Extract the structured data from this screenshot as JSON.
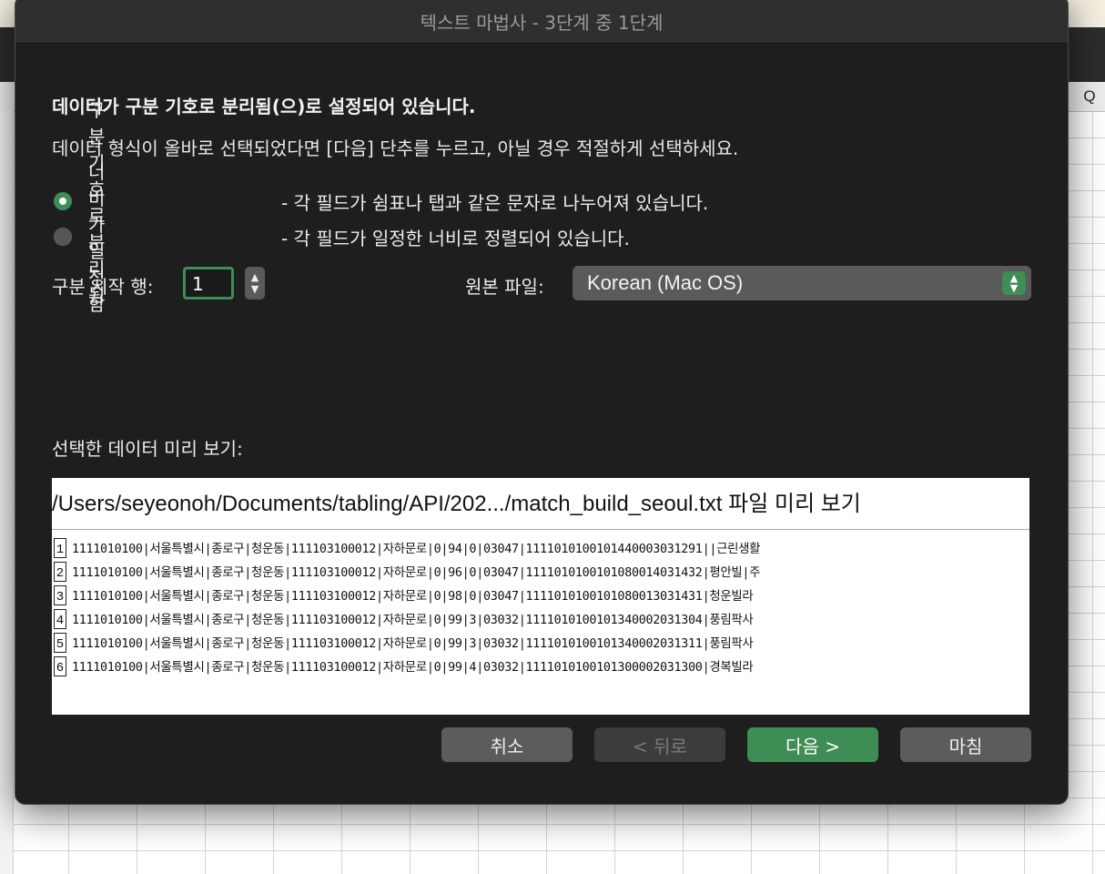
{
  "sheet": {
    "col_q": "Q"
  },
  "dialog": {
    "title": "텍스트 마법사 - 3단계 중 1단계",
    "heading": "데이터가 구분 기호로 분리됨(으)로 설정되어 있습니다.",
    "subtext": "데이터 형식이 올바로 선택되었다면 [다음] 단추를 누르고, 아닐 경우 적절하게 선택하세요.",
    "options": [
      {
        "label": "구분 기호로 분리됨",
        "desc": "- 각 필드가 쉼표나 탭과 같은 문자로 나누어져 있습니다.",
        "selected": true
      },
      {
        "label": "너비가 일정함",
        "desc": "- 각 필드가 일정한 너비로 정렬되어 있습니다.",
        "selected": false
      }
    ],
    "start_row": {
      "label": "구분 시작 행:",
      "value": "1"
    },
    "origin": {
      "label": "원본 파일:",
      "value": "Korean (Mac OS)"
    },
    "preview": {
      "label": "선택한 데이터 미리 보기:",
      "title": "/Users/seyeonoh/Documents/tabling/API/202.../match_build_seoul.txt 파일 미리 보기",
      "rows": [
        {
          "num": "1",
          "text": "1111010100|서울특별시|종로구|청운동|111103100012|자하문로|0|94|0|03047|1111010100101440003031291||근린생활"
        },
        {
          "num": "2",
          "text": "1111010100|서울특별시|종로구|청운동|111103100012|자하문로|0|96|0|03047|1111010100101080014031432|평안빌|주"
        },
        {
          "num": "3",
          "text": "1111010100|서울특별시|종로구|청운동|111103100012|자하문로|0|98|0|03047|1111010100101080013031431|청운빌라"
        },
        {
          "num": "4",
          "text": "1111010100|서울특별시|종로구|청운동|111103100012|자하문로|0|99|3|03032|1111010100101340002031304|풍림팍사"
        },
        {
          "num": "5",
          "text": "1111010100|서울특별시|종로구|청운동|111103100012|자하문로|0|99|3|03032|1111010100101340002031311|풍림팍사"
        },
        {
          "num": "6",
          "text": "1111010100|서울특별시|종로구|청운동|111103100012|자하문로|0|99|4|03032|1111010100101300002031300|경복빌라"
        }
      ]
    },
    "buttons": {
      "cancel": "취소",
      "back": "< 뒤로",
      "next": "다음 >",
      "finish": "마침"
    }
  },
  "colors": {
    "accent": "#3d8d55",
    "dialog_bg": "#1e1e1e",
    "button_gray": "#5c5c5c"
  }
}
